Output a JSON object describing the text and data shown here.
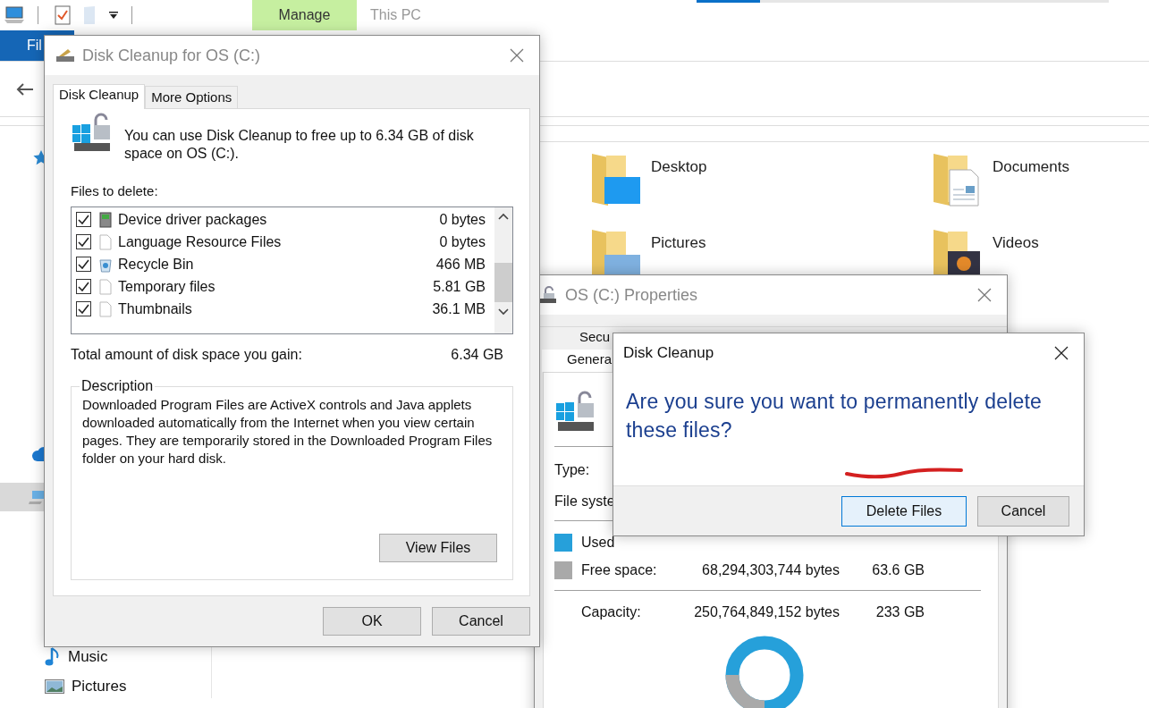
{
  "explorer": {
    "contextual_tab": "Manage",
    "window_title": "This PC",
    "file_tab": "Fil",
    "sidebar": [
      {
        "kind": "quick-access",
        "selected": false
      },
      {
        "kind": "onedrive",
        "selected": false
      },
      {
        "kind": "this-pc",
        "selected": true
      },
      {
        "kind": "music",
        "label": "Music",
        "selected": false
      },
      {
        "kind": "pictures",
        "label": "Pictures",
        "selected": false
      }
    ],
    "folders": [
      {
        "name": "Desktop",
        "kind": "desktop"
      },
      {
        "name": "Documents",
        "kind": "documents"
      },
      {
        "name": "Pictures",
        "kind": "pictures"
      },
      {
        "name": "Videos",
        "kind": "videos"
      }
    ]
  },
  "disk_cleanup": {
    "title": "Disk Cleanup for OS (C:)",
    "tabs": [
      {
        "label": "Disk Cleanup",
        "selected": true
      },
      {
        "label": "More Options",
        "selected": false
      }
    ],
    "intro": "You can use Disk Cleanup to free up to 6.34 GB of disk space on OS (C:).",
    "files_label": "Files to delete:",
    "files": [
      {
        "name": "Device driver packages",
        "size": "0 bytes",
        "checked": true,
        "kind": "driver"
      },
      {
        "name": "Language Resource Files",
        "size": "0 bytes",
        "checked": true,
        "kind": "blank"
      },
      {
        "name": "Recycle Bin",
        "size": "466 MB",
        "checked": true,
        "kind": "recycle"
      },
      {
        "name": "Temporary files",
        "size": "5.81 GB",
        "checked": true,
        "kind": "blank"
      },
      {
        "name": "Thumbnails",
        "size": "36.1 MB",
        "checked": true,
        "kind": "blank"
      }
    ],
    "total_label": "Total amount of disk space you gain:",
    "total": "6.34 GB",
    "description_label": "Description",
    "description": "Downloaded Program Files are ActiveX controls and Java applets downloaded automatically from the Internet when you view certain pages. They are temporarily stored in the Downloaded Program Files folder on your hard disk.",
    "view_files": "View Files",
    "buttons": [
      "OK",
      "Cancel"
    ]
  },
  "properties": {
    "title": "OS (C:) Properties",
    "tab_rows": [
      [
        {
          "label": "Secu",
          "selected": false
        }
      ],
      [
        {
          "label": "Genera",
          "selected": true
        }
      ]
    ],
    "fields": [
      "Type:",
      "File syste"
    ],
    "space": [
      {
        "label": "Used",
        "color": "#26a0da"
      },
      {
        "label": "Free space:",
        "bytes": "68,294,303,744 bytes",
        "size": "63.6 GB",
        "color": "#a9a9a9"
      }
    ],
    "capacity": {
      "label": "Capacity:",
      "bytes": "250,764,849,152 bytes",
      "size": "233 GB"
    }
  },
  "confirm": {
    "title": "Disk Cleanup",
    "question": "Are you sure you want to permanently delete these files?",
    "buttons": [
      {
        "label": "Delete Files",
        "default": true
      },
      {
        "label": "Cancel",
        "default": false
      }
    ]
  }
}
